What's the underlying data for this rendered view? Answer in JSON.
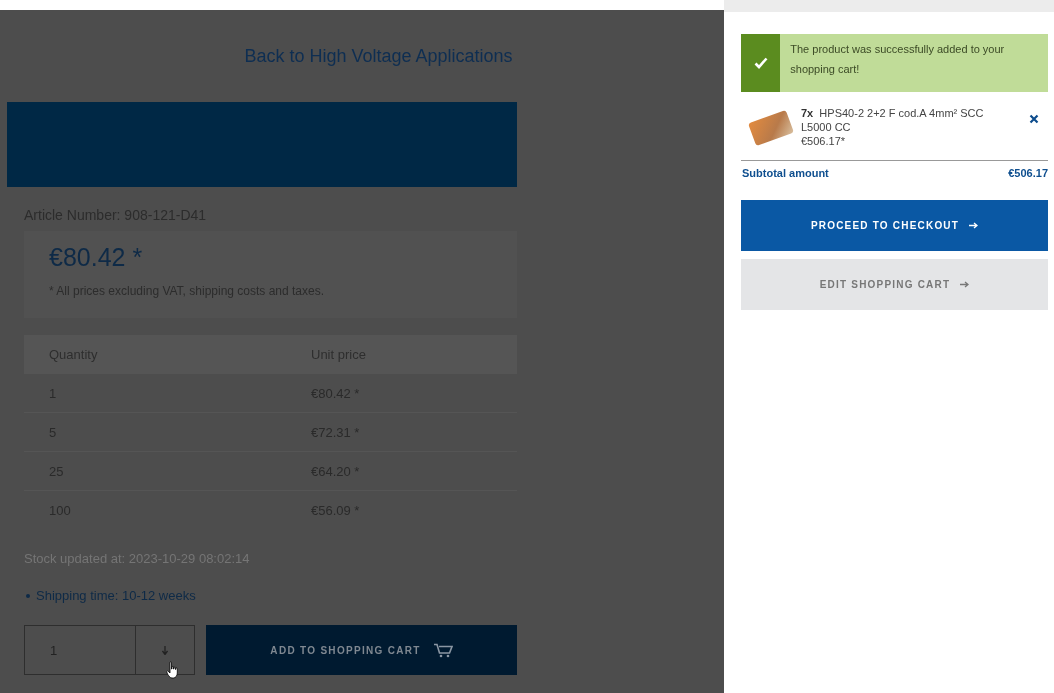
{
  "back_link": "Back to High Voltage Applications",
  "article_number": "Article Number: 908-121-D41",
  "price": {
    "value": "€80.42 *",
    "note": "* All prices excluding VAT, shipping costs and taxes."
  },
  "price_table": {
    "columns": [
      "Quantity",
      "Unit price"
    ],
    "rows": [
      [
        "1",
        "€80.42 *"
      ],
      [
        "5",
        "€72.31 *"
      ],
      [
        "25",
        "€64.20 *"
      ],
      [
        "100",
        "€56.09 *"
      ]
    ]
  },
  "stock_updated": "Stock updated at: 2023-10-29 08:02:14",
  "shipping_time": "Shipping time: 10-12 weeks",
  "quantity_select": {
    "value": "1"
  },
  "add_to_cart_button": "ADD TO SHOPPING CART",
  "cart_panel": {
    "success_message": "The product was successfully added to your shopping cart!",
    "items": [
      {
        "quantity": "7x",
        "name": "HPS40-2 2+2 F cod.A 4mm² SCC L5000 CC",
        "price": "€506.17*"
      }
    ],
    "subtotal_label": "Subtotal amount",
    "subtotal_value": "€506.17",
    "checkout_button": "PROCEED TO CHECKOUT",
    "edit_button": "EDIT SHOPPING CART"
  }
}
